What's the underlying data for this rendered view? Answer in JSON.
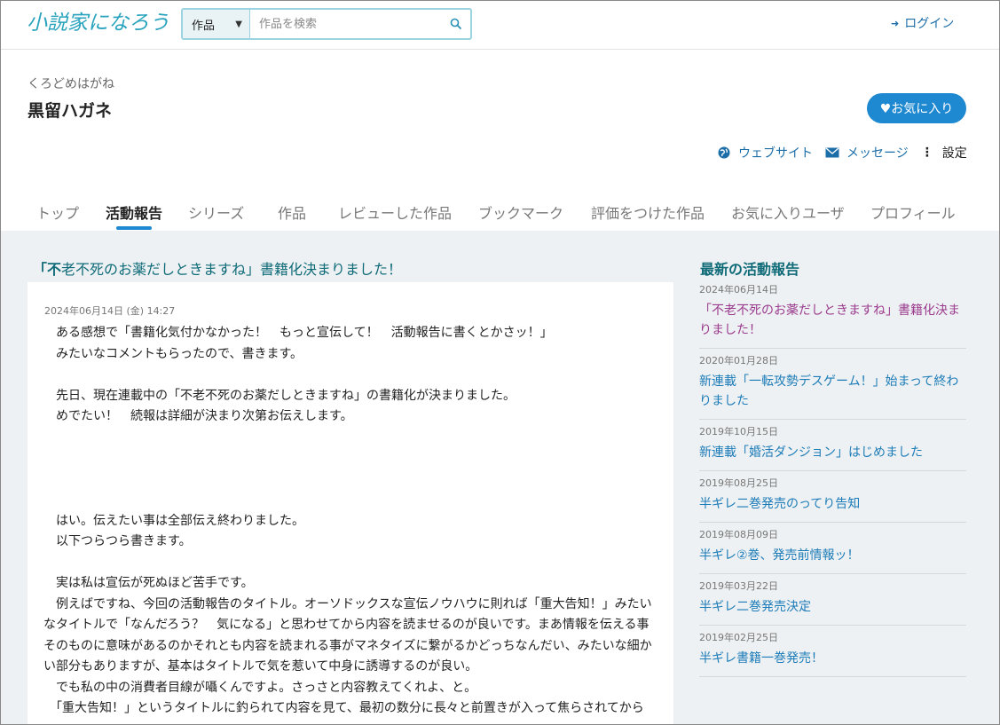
{
  "header": {
    "logo_text": "小説家になろう",
    "search_category": "作品",
    "search_placeholder": "作品を検索",
    "login_label": "ログイン"
  },
  "profile": {
    "kana": "くろどめはがね",
    "name": "黒留ハガネ",
    "favorite_label": "♥お気に入り",
    "website_label": "ウェブサイト",
    "message_label": "メッセージ",
    "settings_label": "設定"
  },
  "tabs": [
    {
      "label": "トップ"
    },
    {
      "label": "活動報告"
    },
    {
      "label": "シリーズ"
    },
    {
      "label": "作品"
    },
    {
      "label": "レビューした作品"
    },
    {
      "label": "ブックマーク"
    },
    {
      "label": "評価をつけた作品"
    },
    {
      "label": "お気に入りユーザ"
    },
    {
      "label": "プロフィール"
    }
  ],
  "article": {
    "title_first": "「不",
    "title_rest": "老不死のお薬だしときますね」書籍化決まりました！",
    "date": "2024年06月14日 (金) 14:27",
    "lines": [
      "　ある感想で「書籍化気付かなかった！　もっと宣伝して！　活動報告に書くとかさッ！」",
      "　みたいなコメントもらったので、書きます。",
      "",
      "　先日、現在連載中の「不老不死のお薬だしときますね」の書籍化が決まりました。",
      "　めでたい！　続報は詳細が決まり次第お伝えします。",
      "",
      "",
      "",
      "",
      "　はい。伝えたい事は全部伝え終わりました。",
      "　以下つらつら書きます。",
      "",
      "　実は私は宣伝が死ぬほど苦手です。",
      "　例えばですね、今回の活動報告のタイトル。オーソドックスな宣伝ノウハウに則れば「重大告知！」みたい",
      "なタイトルで「なんだろう？　気になる」と思わせてから内容を読ませるのが良いです。まあ情報を伝える事",
      "そのものに意味があるのかそれとも内容を読まれる事がマネタイズに繋がるかどっちなんだい、みたいな細か",
      "い部分もありますが、基本はタイトルで気を惹いて中身に誘導するのが良い。",
      "　でも私の中の消費者目線が囁くんですよ。さっさと内容教えてくれよ、と。",
      "　「重大告知！」というタイトルに釣られて内容を見て、最初の数分に長々と前置きが入って焦らされてから"
    ]
  },
  "sidebar": {
    "title": "最新の活動報告",
    "items": [
      {
        "date": "2024年06月14日",
        "title": "「不老不死のお薬だしときますね」書籍化決まりました！"
      },
      {
        "date": "2020年01月28日",
        "title": "新連載「一転攻勢デスゲーム！」始まって終わりました"
      },
      {
        "date": "2019年10月15日",
        "title": "新連載「婚活ダンジョン」はじめました"
      },
      {
        "date": "2019年08月25日",
        "title": "半ギレ二巻発売のってり告知"
      },
      {
        "date": "2019年08月09日",
        "title": "半ギレ②巻、発売前情報ッ！"
      },
      {
        "date": "2019年03月22日",
        "title": "半ギレ二巻発売決定"
      },
      {
        "date": "2019年02月25日",
        "title": "半ギレ書籍一巻発売！"
      }
    ]
  }
}
